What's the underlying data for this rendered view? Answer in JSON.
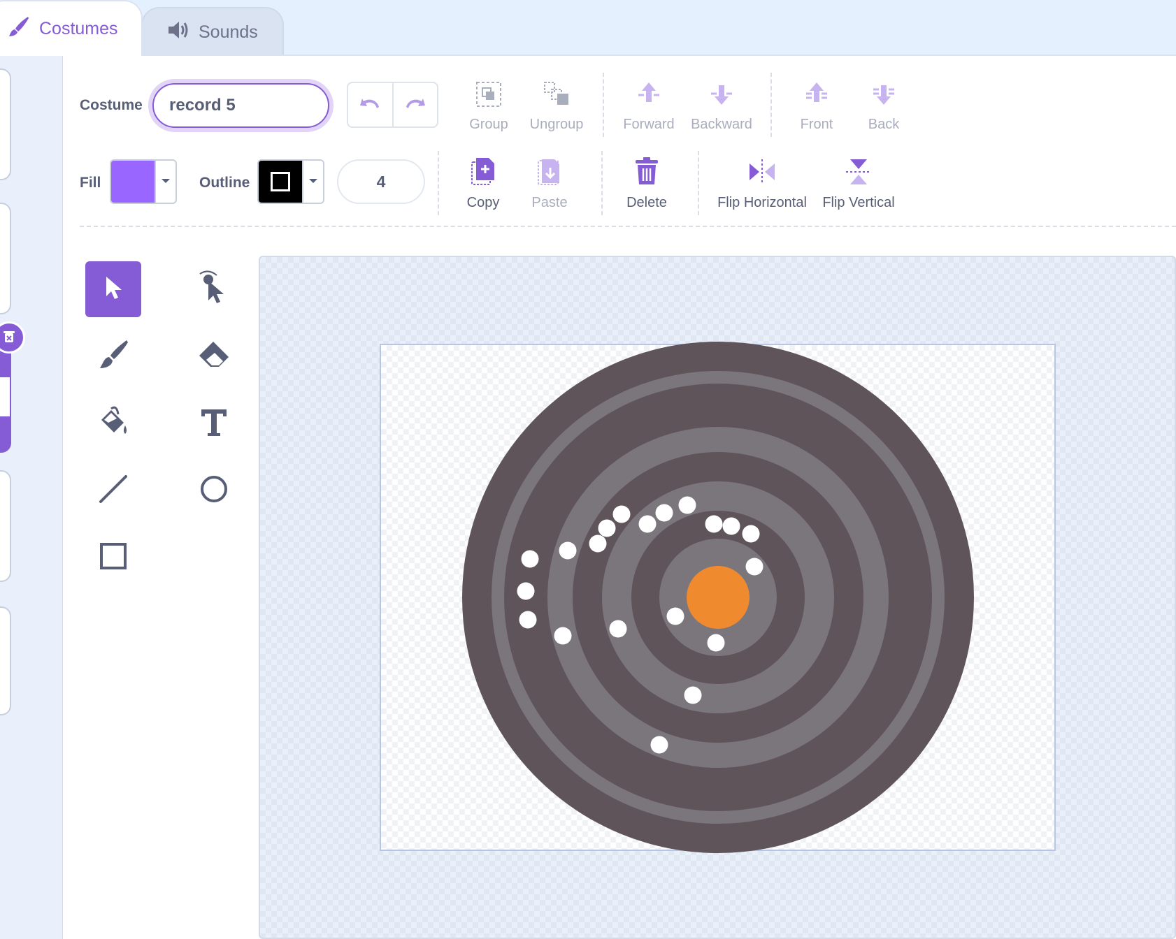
{
  "tabs": {
    "costumes": "Costumes",
    "sounds": "Sounds"
  },
  "costume": {
    "label": "Costume",
    "name": "record 5"
  },
  "fill": {
    "label": "Fill",
    "color": "#9966ff"
  },
  "outline": {
    "label": "Outline",
    "color": "#000000",
    "width": "4"
  },
  "toolbar": {
    "group": "Group",
    "ungroup": "Ungroup",
    "forward": "Forward",
    "backward": "Backward",
    "front": "Front",
    "back": "Back",
    "copy": "Copy",
    "paste": "Paste",
    "delete": "Delete",
    "flip_horizontal": "Flip Horizontal",
    "flip_vertical": "Flip Vertical"
  },
  "tools": [
    "select",
    "reshape",
    "brush",
    "eraser",
    "fill",
    "text",
    "line",
    "circle",
    "rectangle"
  ],
  "selected_tool": "select",
  "colors": {
    "accent": "#855cd6",
    "record_dark": "#5f5459",
    "record_light": "#7b767c",
    "label_orange": "#ef8a2f",
    "dot": "#ffffff"
  }
}
